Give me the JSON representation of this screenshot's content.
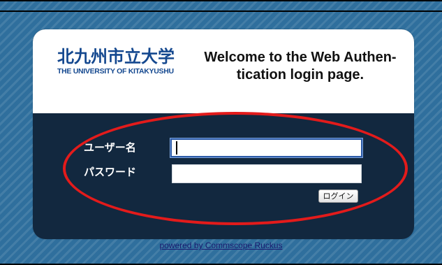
{
  "header": {
    "logo_kanji": "北九州市立大学",
    "logo_english": "THE UNIVERSITY OF KITAKYUSHU",
    "welcome_line1": "Welcome to the Web Authen-",
    "welcome_line2": "tication login page."
  },
  "form": {
    "username_label": "ユーザー名",
    "password_label": "パスワード",
    "username_value": "",
    "password_value": "",
    "login_button": "ログイン"
  },
  "footer": {
    "powered_by": "powered by Commscope Ruckus"
  },
  "colors": {
    "background": "#2f6f9d",
    "panel": "#12283f",
    "logo_blue": "#14488f",
    "annotation_red": "#e31b1b"
  },
  "icons": {
    "annotation": "red-ellipse-highlight"
  }
}
